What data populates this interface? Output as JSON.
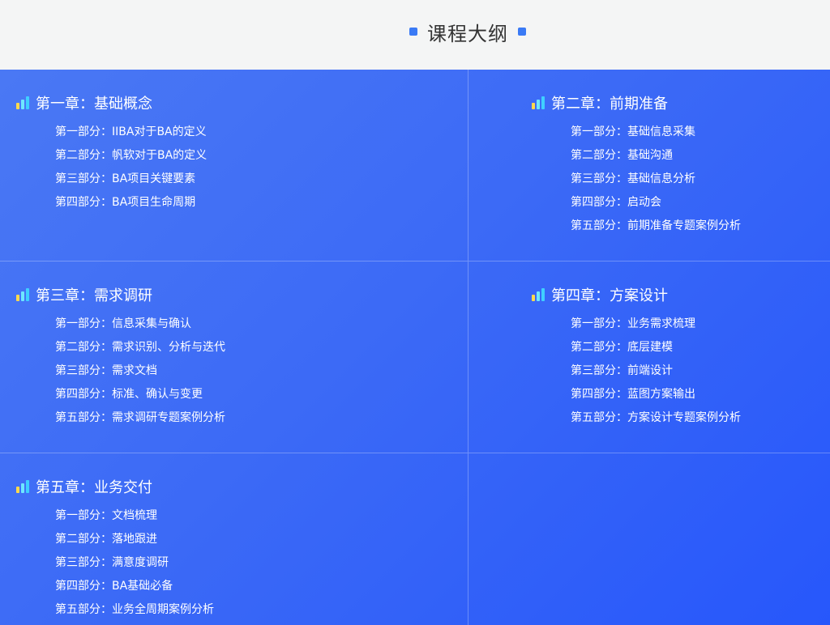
{
  "header": {
    "title": "课程大纲"
  },
  "chapters": [
    {
      "title": "第一章：基础概念",
      "parts": [
        "第一部分：IIBA对于BA的定义",
        "第二部分：帆软对于BA的定义",
        "第三部分：BA项目关键要素",
        "第四部分：BA项目生命周期"
      ]
    },
    {
      "title": "第二章：前期准备",
      "parts": [
        "第一部分：基础信息采集",
        "第二部分：基础沟通",
        "第三部分：基础信息分析",
        "第四部分：启动会",
        "第五部分：前期准备专题案例分析"
      ]
    },
    {
      "title": "第三章：需求调研",
      "parts": [
        "第一部分：信息采集与确认",
        "第二部分：需求识别、分析与迭代",
        "第三部分：需求文档",
        "第四部分：标准、确认与变更",
        "第五部分：需求调研专题案例分析"
      ]
    },
    {
      "title": "第四章：方案设计",
      "parts": [
        "第一部分：业务需求梳理",
        "第二部分：底层建模",
        "第三部分：前端设计",
        "第四部分：蓝图方案输出",
        "第五部分：方案设计专题案例分析"
      ]
    },
    {
      "title": "第五章：业务交付",
      "parts": [
        "第一部分：文档梳理",
        "第二部分：落地跟进",
        "第三部分：满意度调研",
        "第四部分：BA基础必备",
        "第五部分：业务全周期案例分析"
      ]
    }
  ],
  "icons": {
    "chapter_icon": "bar-chart-icon",
    "title_marker": "square-icon"
  },
  "colors": {
    "accent": "#3a7af5",
    "panel_start": "#4a78f4",
    "panel_end": "#2757fb"
  }
}
